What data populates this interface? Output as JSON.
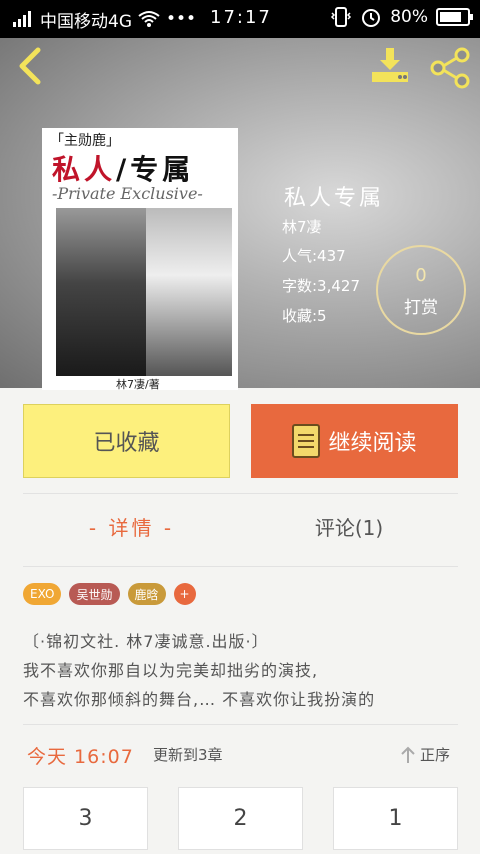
{
  "status_bar": {
    "carrier": "中国移动4G",
    "dots": "•••",
    "time": "17:17",
    "battery": "80%",
    "battery_level": 0.8
  },
  "header": {
    "cover": {
      "top_tag": "「主勋鹿」",
      "title_red": "私人",
      "title_black": "/专属",
      "subtitle": "-Private Exclusive-",
      "author_line": "林7凄/著"
    },
    "book_title": "私人专属",
    "author": "林7凄",
    "popularity": "人气:437",
    "word_count": "字数:3,427",
    "favorites": "收藏:5",
    "tip": {
      "count": "0",
      "label": "打赏"
    }
  },
  "actions": {
    "collected_label": "已收藏",
    "read_label": "继续阅读"
  },
  "tabs": {
    "detail": "- 详情 -",
    "comments": "评论(1)"
  },
  "tags": [
    {
      "label": "EXO",
      "color": "#f0a734"
    },
    {
      "label": "吴世勋",
      "color": "#b85a54"
    },
    {
      "label": "鹿晗",
      "color": "#c99a3a"
    },
    {
      "label": "+",
      "color": "#e8693e"
    }
  ],
  "description": [
    "〔·锦初文社. 林7凄诚意.出版·〕",
    "我不喜欢你那自以为完美却拙劣的演技,",
    "不喜欢你那倾斜的舞台,… 不喜欢你让我扮演的"
  ],
  "update": {
    "time": "今天 16:07",
    "text": "更新到3章",
    "sort_label": "正序"
  },
  "chapters": [
    "3",
    "2",
    "1"
  ]
}
